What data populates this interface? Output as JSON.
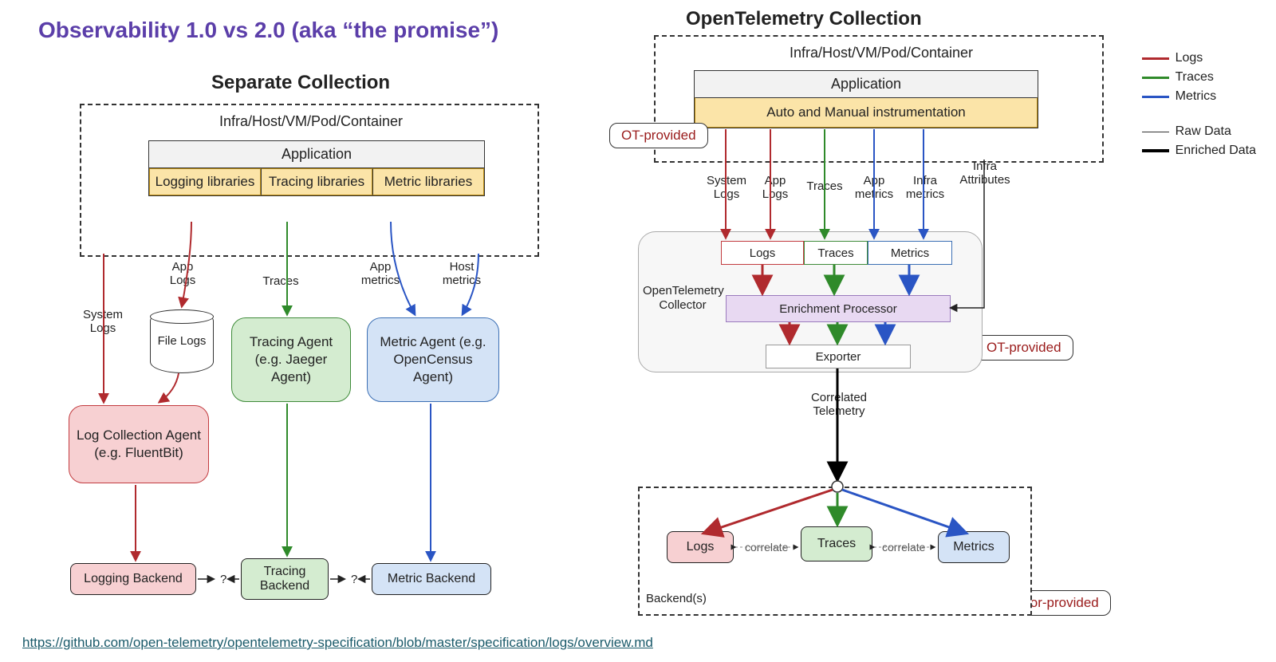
{
  "titles": {
    "main": "Observability 1.0 vs 2.0 (aka “the promise”)",
    "left": "Separate Collection",
    "right": "OpenTelemetry Collection"
  },
  "source_link": "https://github.com/open-telemetry/opentelemetry-specification/blob/master/specification/logs/overview.md",
  "infra_label": "Infra/Host/VM/Pod/Container",
  "application": "Application",
  "left": {
    "libs": {
      "logging": "Logging libraries",
      "tracing": "Tracing libraries",
      "metric": "Metric libraries"
    },
    "flows": {
      "system_logs": "System Logs",
      "app_logs": "App Logs",
      "traces": "Traces",
      "app_metrics": "App metrics",
      "host_metrics": "Host metrics"
    },
    "file_logs": "File Logs",
    "agents": {
      "log": "Log Collection Agent (e.g. FluentBit)",
      "trace": "Tracing Agent (e.g. Jaeger Agent)",
      "metric": "Metric Agent (e.g. OpenCensus Agent)"
    },
    "backends": {
      "log": "Logging Backend",
      "trace": "Tracing Backend",
      "metric": "Metric Backend"
    },
    "question": "?"
  },
  "right": {
    "instrumentation": "Auto and Manual instrumentation",
    "flows": {
      "system_logs": "System Logs",
      "app_logs": "App Logs",
      "traces": "Traces",
      "app_metrics": "App metrics",
      "infra_metrics": "Infra metrics",
      "infra_attrs": "Infra Attributes"
    },
    "collector": {
      "label": "OpenTelemetry Collector",
      "logs": "Logs",
      "traces": "Traces",
      "metrics": "Metrics",
      "enrichment": "Enrichment Processor",
      "exporter": "Exporter"
    },
    "correlated": "Correlated Telemetry",
    "backends": {
      "logs": "Logs",
      "traces": "Traces",
      "metrics": "Metrics",
      "label": "Backend(s)",
      "correlate": "correlate"
    }
  },
  "callouts": {
    "ot": "OT-provided",
    "vendor": "Vendor-provided"
  },
  "legend": {
    "logs": "Logs",
    "traces": "Traces",
    "metrics": "Metrics",
    "raw": "Raw Data",
    "enriched": "Enriched Data"
  },
  "colors": {
    "logs": "#b02a2e",
    "traces": "#2f8a2a",
    "metrics": "#2a55c4",
    "black": "#222"
  }
}
